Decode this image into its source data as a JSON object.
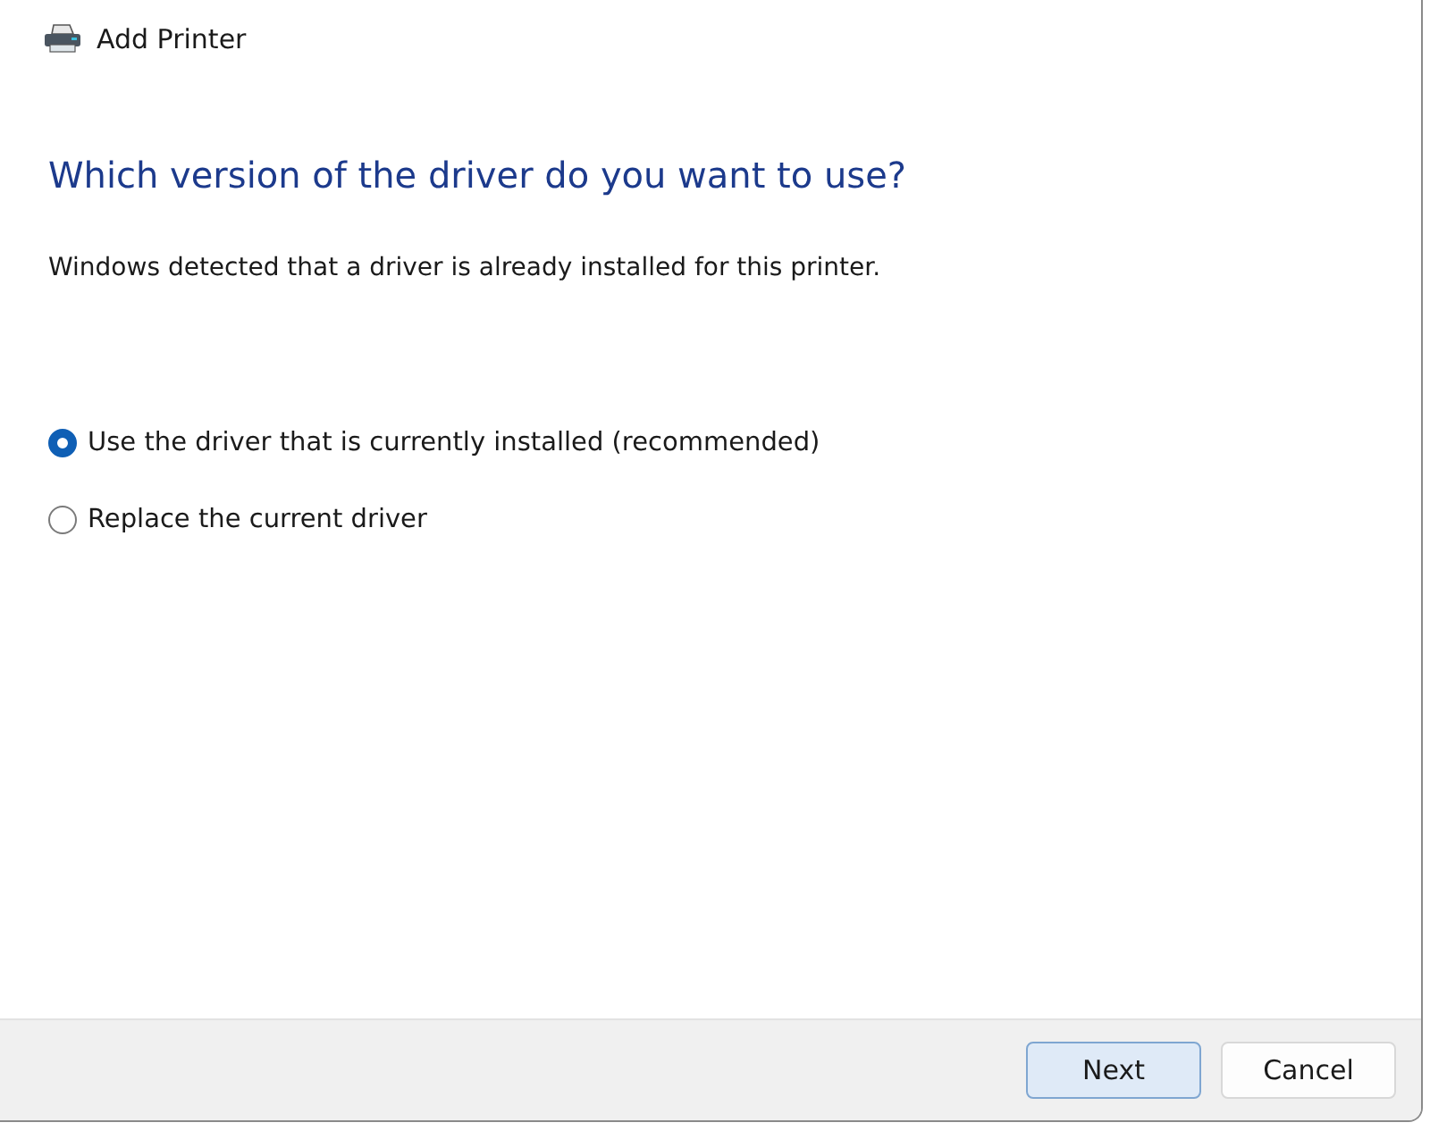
{
  "window": {
    "title": "Add Printer"
  },
  "heading": "Which version of the driver do you want to use?",
  "message": "Windows detected that a driver is already installed for this printer.",
  "options": [
    {
      "label": "Use the driver that is currently installed (recommended)",
      "selected": true
    },
    {
      "label": "Replace the current driver",
      "selected": false
    }
  ],
  "buttons": [
    {
      "label": "Next",
      "kind": "default"
    },
    {
      "label": "Cancel",
      "kind": "normal"
    }
  ]
}
